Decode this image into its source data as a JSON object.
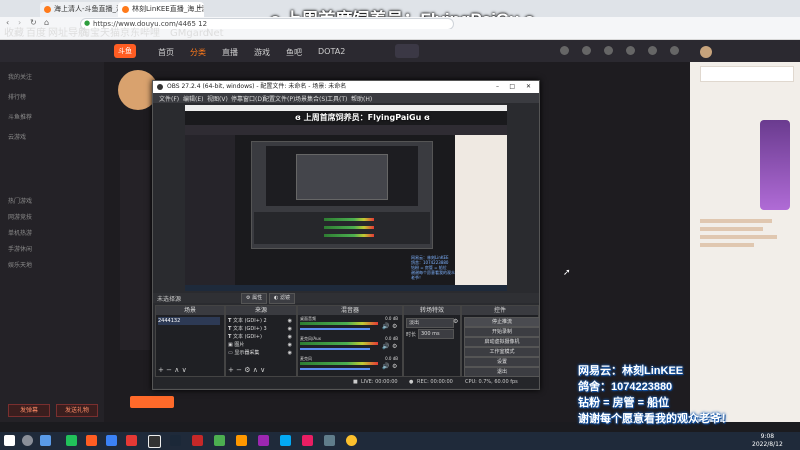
{
  "browser": {
    "tabs": [
      {
        "label": "海上清人-斗鱼直播_海上清人..."
      },
      {
        "label": "林刻LinKEE直播_海上清人..."
      }
    ],
    "url": "https://www.douyu.com/4465 12",
    "bookmarks": [
      "收藏",
      "百度",
      "网址导航",
      "淘宝",
      "天猫",
      "京东",
      "哔哩",
      "GMgard",
      "Net"
    ]
  },
  "overlay": {
    "title": "ɞ 上周首席饲养员：FlyingPaiGu ɞ",
    "lines": [
      "网易云：林刻LinKEE",
      "鸽舍：1074223880",
      "钻粉 = 房管 = 船位",
      "谢谢每个愿意看我的观众老爷！"
    ]
  },
  "douyu": {
    "logo": "斗鱼",
    "nav": [
      "首页",
      "分类",
      "直播",
      "游戏",
      "鱼吧",
      "DOTA2"
    ],
    "sidebar": [
      "我的关注",
      "排行榜",
      "斗鱼推荐",
      "云游戏"
    ],
    "sidebar_extra": [
      "热门游戏",
      "网游竞技",
      "单机热游",
      "手游休闲",
      "娱乐天地"
    ],
    "bottom_buttons": [
      "发弹幕",
      "发送礼物"
    ]
  },
  "obs": {
    "title": "OBS 27.2.4 (64-bit, windows) - 配置文件: 未命名 - 场景: 未命名",
    "menu": [
      "文件(F)",
      "编辑(E)",
      "视图(V)",
      "停靠窗口(D)",
      "配置文件(P)",
      "场景集合(S)",
      "工具(T)",
      "帮助(H)"
    ],
    "source_bar": {
      "label": "未选择源",
      "props": "属性",
      "filters": "滤镜"
    },
    "docks": {
      "scenes": {
        "title": "场景",
        "items": [
          "2444132"
        ]
      },
      "sources": {
        "title": "来源",
        "items": [
          "文本 (GDI+) 2",
          "文本 (GDI+) 3",
          "文本 (GDI+)",
          "图片",
          "显示器采集"
        ]
      },
      "mixer": {
        "title": "混音器",
        "channels": [
          {
            "name": "桌面音频",
            "db": "0.0 dB"
          },
          {
            "name": "麦克风/Aux",
            "db": "0.0 dB"
          },
          {
            "name": "麦克风",
            "db": "0.0 dB"
          }
        ]
      },
      "transitions": {
        "title": "转场特效",
        "type": "淡出",
        "duration_label": "时长",
        "duration": "300 ms"
      },
      "controls": {
        "title": "控件",
        "buttons": [
          "停止推流",
          "开始录制",
          "启动虚拟摄像机",
          "工作室模式",
          "设置",
          "退出"
        ]
      }
    },
    "status": {
      "live": "LIVE: 00:00:00",
      "rec": "REC: 00:00:00",
      "cpu": "CPU: 0.7%, 60.00 fps"
    }
  },
  "taskbar": {
    "time": "9:08",
    "date": "2022/8/12"
  },
  "colors": {
    "accent": "#ff7a1a",
    "overlay_text_glow": "#1a5fb4",
    "obs_bg": "#2a2b2f"
  }
}
